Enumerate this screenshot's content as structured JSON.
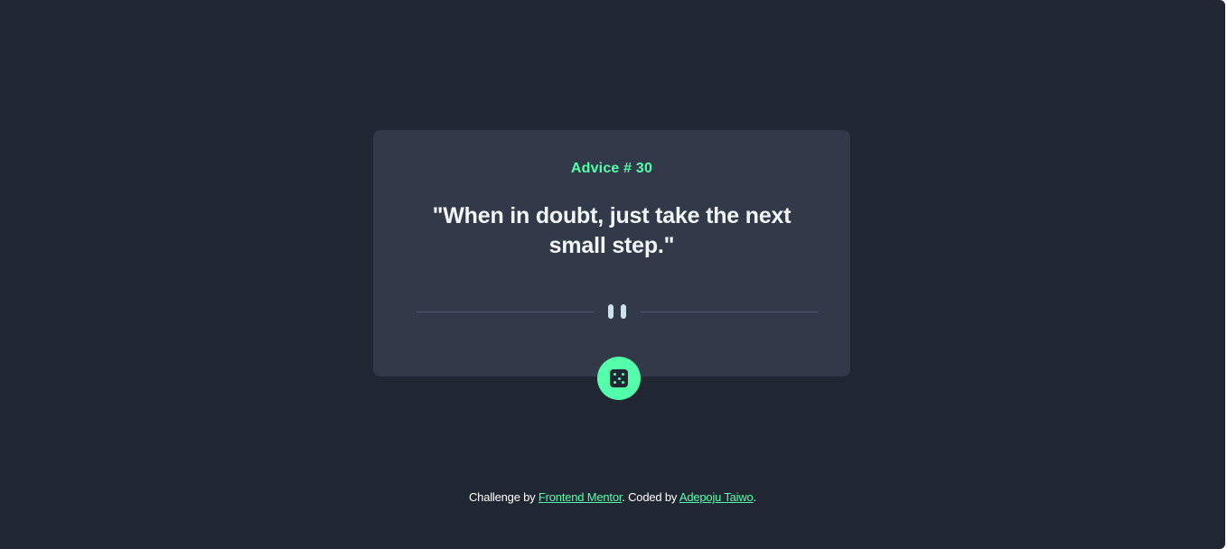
{
  "card": {
    "advice_label": "Advice # 30",
    "quote": "\"When in doubt, just take the next small step.\""
  },
  "divider": {
    "icon": "pause-icon"
  },
  "dice_button": {
    "icon": "dice-icon"
  },
  "footer": {
    "prefix": "Challenge by ",
    "link1": "Frontend Mentor",
    "middle": ". Coded by ",
    "link2": "Adepoju Taiwo",
    "suffix": "."
  },
  "colors": {
    "background": "#202632",
    "card": "#323a49",
    "accent": "#53ffaa",
    "text": "#f2f6f7",
    "divider": "#4f5d74"
  }
}
